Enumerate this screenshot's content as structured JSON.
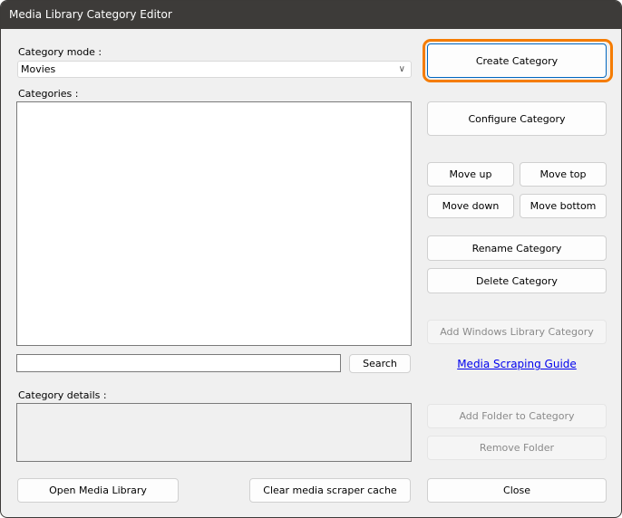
{
  "window": {
    "title": "Media Library Category Editor"
  },
  "left": {
    "category_mode_label": "Category mode :",
    "category_mode_value": "Movies",
    "categories_label": "Categories :",
    "search_value": "",
    "search_button": "Search",
    "details_label": "Category details :",
    "open_library_button": "Open Media Library",
    "clear_cache_button": "Clear media scraper cache"
  },
  "right": {
    "create": "Create Category",
    "configure": "Configure Category",
    "move_up": "Move up",
    "move_top": "Move top",
    "move_down": "Move down",
    "move_bottom": "Move bottom",
    "rename": "Rename Category",
    "delete": "Delete Category",
    "add_windows_library": "Add Windows Library Category",
    "scraping_guide": "Media Scraping Guide",
    "add_folder": "Add Folder to Category",
    "remove_folder": "Remove Folder",
    "close": "Close"
  },
  "colors": {
    "highlight": "#f57c00",
    "titlebar": "#3d3b39",
    "link": "#0000ee"
  }
}
